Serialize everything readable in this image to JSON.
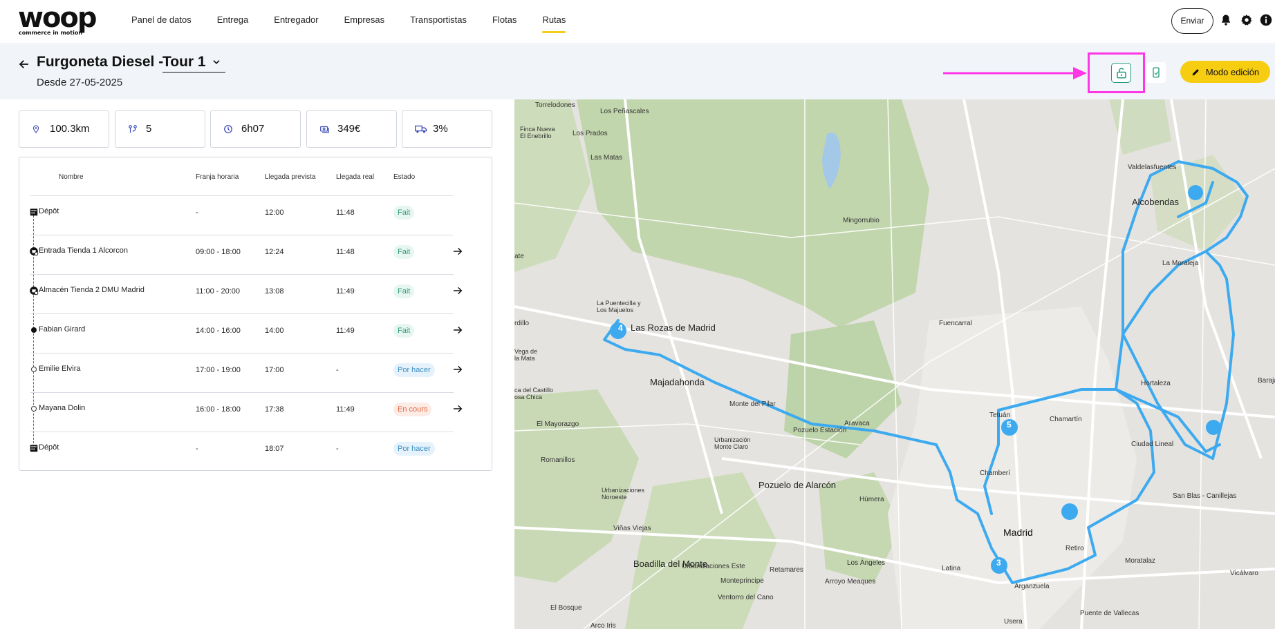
{
  "brand": {
    "name": "woop",
    "tagline": "commerce in motion"
  },
  "nav": {
    "items": [
      {
        "label": "Panel de datos"
      },
      {
        "label": "Entrega"
      },
      {
        "label": "Entregador"
      },
      {
        "label": "Empresas"
      },
      {
        "label": "Transportistas"
      },
      {
        "label": "Flotas"
      },
      {
        "label": "Rutas",
        "active": true
      }
    ],
    "send_label": "Enviar"
  },
  "route": {
    "title": "Furgoneta Diesel -",
    "tour": "Tour 1",
    "since": "Desde 27-05-2025",
    "edit_label": "Modo edición"
  },
  "stats": [
    {
      "icon": "pin-icon",
      "value": "100.3km"
    },
    {
      "icon": "stops-icon",
      "value": "5"
    },
    {
      "icon": "clock-icon",
      "value": "6h07"
    },
    {
      "icon": "money-icon",
      "value": "349€"
    },
    {
      "icon": "truck-icon",
      "value": "3%"
    }
  ],
  "table": {
    "headers": [
      "Nombre",
      "Franja horaria",
      "Llegada prevista",
      "Llegada real",
      "Estado"
    ],
    "rows": [
      {
        "name": "Dépôt",
        "window": "-",
        "planned": "12:00",
        "actual": "11:48",
        "status": "Fait",
        "kind": "done",
        "marker": "depot",
        "arrow": false
      },
      {
        "name": "Entrada Tienda 1 Alcorcon",
        "window": "09:00 - 18:00",
        "planned": "12:24",
        "actual": "11:48",
        "status": "Fait",
        "kind": "done",
        "marker": "store",
        "arrow": true
      },
      {
        "name": "Almacén Tienda 2 DMU Madrid",
        "window": "11:00 - 20:00",
        "planned": "13:08",
        "actual": "11:49",
        "status": "Fait",
        "kind": "done",
        "marker": "store",
        "arrow": true
      },
      {
        "name": "Fabian Girard",
        "window": "14:00 - 16:00",
        "planned": "14:00",
        "actual": "11:49",
        "status": "Fait",
        "kind": "done",
        "marker": "filled",
        "arrow": true
      },
      {
        "name": "Emilie Elvira",
        "window": "17:00 - 19:00",
        "planned": "17:00",
        "actual": "-",
        "status": "Por hacer",
        "kind": "todo",
        "marker": "open",
        "arrow": true
      },
      {
        "name": "Mayana Dolin",
        "window": "16:00 - 18:00",
        "planned": "17:38",
        "actual": "11:49",
        "status": "En cours",
        "kind": "cours",
        "marker": "open",
        "arrow": true
      },
      {
        "name": "Dépôt",
        "window": "-",
        "planned": "18:07",
        "actual": "-",
        "status": "Por hacer",
        "kind": "todo",
        "marker": "depot",
        "arrow": false
      }
    ]
  },
  "map": {
    "labels": [
      "Torrelodones",
      "Los Peñascales",
      "Finca Nueva\nEl Enebrillo",
      "Los Prados",
      "Las Matas",
      "Mingorrubio",
      "Valdelasfuentes",
      "Alcobendas",
      "La Moraleja",
      "La Puentecilla y\nLos Majuelos",
      "Las Rozas de Madrid",
      "Fuencarral",
      "Majadahonda",
      "Monte del Pilar",
      "Hortaleza",
      "Tetuán",
      "Chamartín",
      "Aravaca",
      "El Mayorazgo",
      "Pozuelo Estación",
      "Urbanización\nMonte Claro",
      "Ciudad Lineal",
      "Chamberí",
      "Romanillos",
      "Pozuelo de Alarcón",
      "Húmera",
      "Urbanizaciones\nNoroeste",
      "San Blas - Canillejas",
      "Viñas Viejas",
      "Madrid",
      "Retiro",
      "Boadilla del Monte",
      "Urbanizaciones Este",
      "Los Ángeles",
      "Moratalaz",
      "Vicálvaro",
      "Retamares",
      "Latina",
      "Monteprincipe",
      "Arroyo Meaques",
      "Arganzuela",
      "Ventorro del Cano",
      "El Bosque",
      "Puente de Vallecas",
      "Usera",
      "Arco Iris",
      "rdillo",
      "Vega de\nla Mata",
      "ca del Castillo\nosa Chica",
      "ate",
      "Baraja"
    ],
    "markers": [
      "3",
      "4",
      "5"
    ],
    "colors": {
      "route": "#3daaf0",
      "green": "#b7d19f",
      "bg": "#e5e3df"
    }
  },
  "colors": {
    "accent": "#f7cd12",
    "highlight": "#ff36e6",
    "done": "#2f9b7c",
    "todo": "#3b8fc2",
    "cours": "#e2673f"
  }
}
